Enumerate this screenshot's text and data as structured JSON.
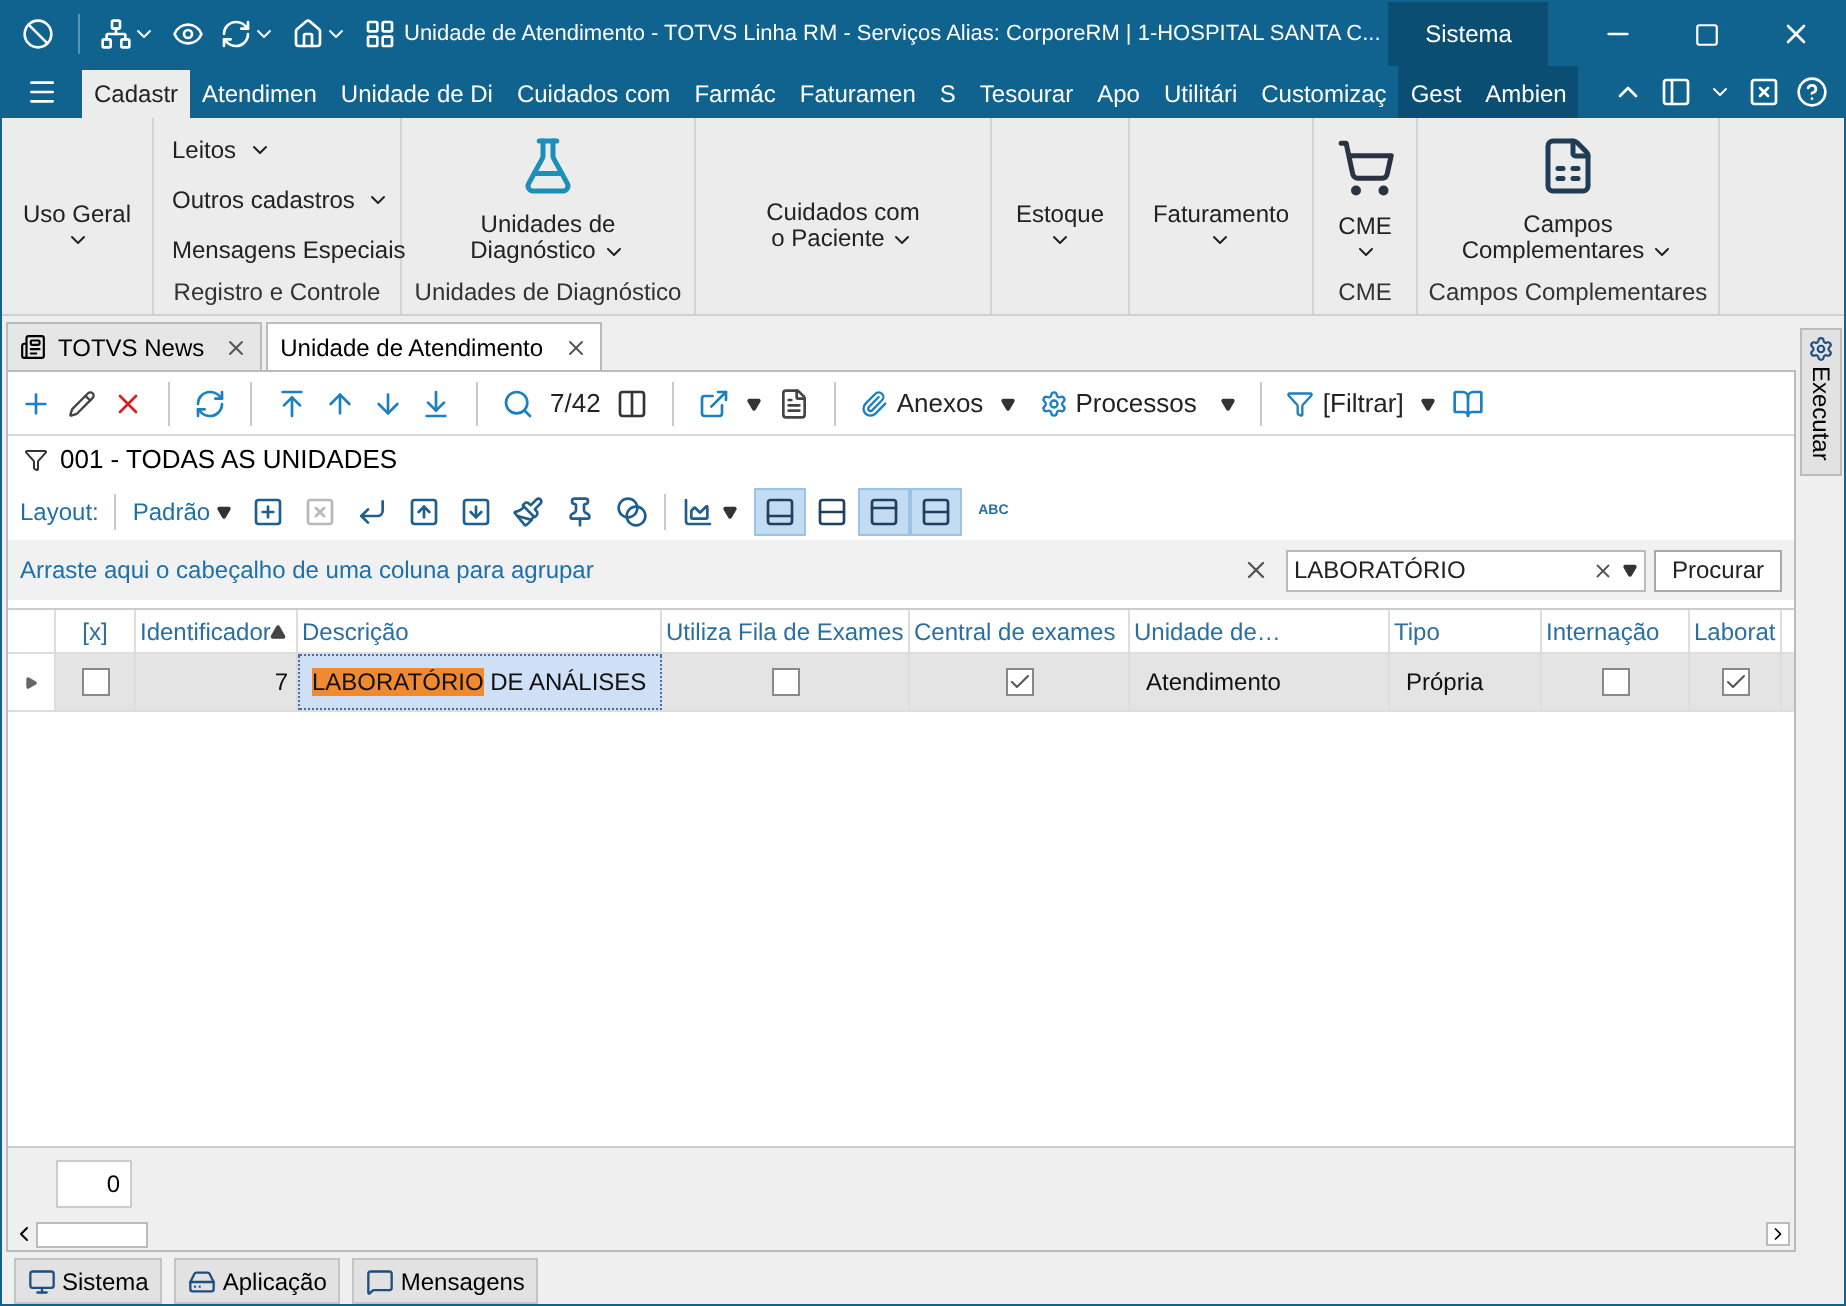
{
  "title_bar": {
    "title": "Unidade de Atendimento - TOTVS Linha RM - Serviços  Alias: CorporeRM | 1-HOSPITAL SANTA C...",
    "context_label": "Sistema"
  },
  "menu_tabs": [
    {
      "label": "Cadastr",
      "selected": true,
      "context": false
    },
    {
      "label": "Atendimen",
      "selected": false,
      "context": false
    },
    {
      "label": "Unidade de Di",
      "selected": false,
      "context": false
    },
    {
      "label": "Cuidados com",
      "selected": false,
      "context": false
    },
    {
      "label": "Farmác",
      "selected": false,
      "context": false
    },
    {
      "label": "Faturamen",
      "selected": false,
      "context": false
    },
    {
      "label": "S",
      "selected": false,
      "context": false
    },
    {
      "label": "Tesourar",
      "selected": false,
      "context": false
    },
    {
      "label": "Apo",
      "selected": false,
      "context": false
    },
    {
      "label": "Utilitári",
      "selected": false,
      "context": false
    },
    {
      "label": "Customizaç",
      "selected": false,
      "context": false
    },
    {
      "label": "Gest",
      "selected": false,
      "context": true
    },
    {
      "label": "Ambien",
      "selected": false,
      "context": true
    }
  ],
  "ribbon": [
    {
      "buttons": [
        {
          "kind": "large",
          "lines": [
            "Uso Geral"
          ],
          "dropdown": true
        }
      ]
    },
    {
      "caption": "Registro e Controle",
      "buttons": [
        {
          "kind": "small",
          "lines": [
            "Leitos"
          ],
          "dropdown": true
        },
        {
          "kind": "small",
          "lines": [
            "Outros cadastros"
          ],
          "dropdown": true
        },
        {
          "kind": "small",
          "lines": [
            "Mensagens  Especiais"
          ]
        }
      ]
    },
    {
      "caption": "Unidades de Diagnóstico",
      "buttons": [
        {
          "kind": "flask",
          "lines": [
            "Unidades de",
            "Diagnóstico"
          ],
          "dropdown": true
        }
      ]
    },
    {
      "buttons": [
        {
          "kind": "large",
          "lines": [
            "Cuidados com",
            "o Paciente"
          ],
          "dropdown": true
        }
      ]
    },
    {
      "buttons": [
        {
          "kind": "large",
          "lines": [
            "Estoque"
          ],
          "dropdown": true
        }
      ]
    },
    {
      "buttons": [
        {
          "kind": "large",
          "lines": [
            "Faturamento"
          ],
          "dropdown": true
        }
      ]
    },
    {
      "caption": "CME",
      "buttons": [
        {
          "kind": "cart",
          "lines": [
            "CME"
          ],
          "dropdown": true
        }
      ]
    },
    {
      "caption": "Campos Complementares",
      "buttons": [
        {
          "kind": "form",
          "lines": [
            "Campos",
            "Complementares"
          ],
          "dropdown": true
        }
      ]
    }
  ],
  "doc_tabs": [
    {
      "label": "TOTVS News",
      "selected": false
    },
    {
      "label": "Unidade de Atendimento",
      "selected": true
    }
  ],
  "toolbar": {
    "counter": "7/42",
    "attachments": "Anexos",
    "processes": "Processos",
    "filter": "[Filtrar]"
  },
  "filter_name": "001 - TODAS AS UNIDADES",
  "layout_bar": {
    "label": "Layout:",
    "preset": "Padrão",
    "tools": [
      {
        "kind": "add",
        "disabled": false
      },
      {
        "kind": "remove",
        "disabled": true
      },
      {
        "kind": "enter",
        "disabled": false
      },
      {
        "kind": "up",
        "disabled": false
      },
      {
        "kind": "down",
        "disabled": false
      },
      {
        "kind": "brush",
        "disabled": false
      },
      {
        "kind": "pin",
        "disabled": false
      },
      {
        "kind": "shapes",
        "disabled": false
      }
    ],
    "views": [
      {
        "kind": "bottom",
        "selected": true
      },
      {
        "kind": "rows",
        "selected": false
      },
      {
        "kind": "top",
        "selected": true
      },
      {
        "kind": "rows",
        "selected": true
      }
    ],
    "text_tool": "ABC"
  },
  "group_bar": {
    "hint": "Arraste aqui o cabeçalho de uma coluna para agrupar",
    "search": "LABORATÓRIO",
    "search_button": "Procurar"
  },
  "table": {
    "columns": [
      {
        "label": "[x]",
        "sorted": false
      },
      {
        "label": "Identificador",
        "sorted": true
      },
      {
        "label": "Descrição",
        "sorted": false
      },
      {
        "label": "Utiliza Fila de Exames",
        "sorted": false
      },
      {
        "label": "Central de exames",
        "sorted": false
      },
      {
        "label": "Unidade de…",
        "sorted": false
      },
      {
        "label": "Tipo",
        "sorted": false
      },
      {
        "label": "Internação",
        "sorted": false
      },
      {
        "label": "Laborat",
        "sorted": false
      }
    ],
    "rows": [
      {
        "cells": [
          {
            "kind": "check",
            "checked": false
          },
          {
            "kind": "number",
            "text": "7"
          },
          {
            "kind": "match",
            "match": "LABORATÓRIO",
            "text": " DE ANÁLISES"
          },
          {
            "kind": "check",
            "checked": false
          },
          {
            "kind": "check",
            "checked": true
          },
          {
            "kind": "text",
            "text": "Atendimento"
          },
          {
            "kind": "text",
            "text": "Própria"
          },
          {
            "kind": "check",
            "checked": false
          },
          {
            "kind": "check",
            "checked": true
          }
        ]
      }
    ],
    "footer_count": "0"
  },
  "side_panel": "Executar",
  "bottom_tabs": [
    "Sistema",
    "Aplicação",
    "Mensagens"
  ]
}
